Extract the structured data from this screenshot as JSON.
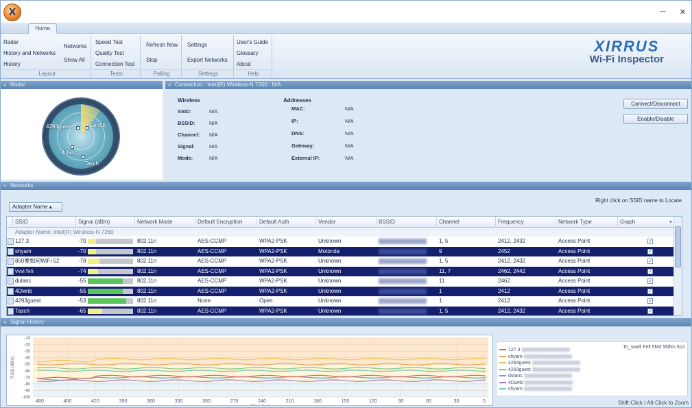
{
  "window": {
    "controls": [
      "⎓",
      "✕"
    ]
  },
  "ribbon": {
    "tab": "Home",
    "groups": {
      "layout": {
        "label": "Layout",
        "items": [
          "Radar",
          "History and Networks",
          "History"
        ],
        "networks": "Networks",
        "show_all": "Show All"
      },
      "tests": {
        "label": "Tests",
        "items": [
          "Speed Test",
          "Quality Test",
          "Connection Test"
        ]
      },
      "polling": {
        "label": "Polling",
        "refresh": "Refresh Now",
        "stop": "Stop"
      },
      "settings": {
        "label": "Settings",
        "settings": "Settings",
        "export": "Export Networks"
      },
      "help": {
        "label": "Help",
        "items": [
          "User's Guide",
          "Glossary",
          "About"
        ]
      }
    },
    "brand": {
      "name": "XIRRUS",
      "product": "Wi-Fi Inspector"
    }
  },
  "radar": {
    "header": "Radar",
    "labels": [
      "4293guest",
      "Ssmdb",
      "dulanc",
      "Tasch"
    ]
  },
  "connection": {
    "header": "Connection : Intel(R) Wireless-N 7260 : N/A",
    "wireless": {
      "title": "Wireless",
      "fields": [
        {
          "label": "SSID:",
          "value": "N/A"
        },
        {
          "label": "BSSID:",
          "value": "N/A"
        },
        {
          "label": "Channel:",
          "value": "N/A"
        },
        {
          "label": "Signal:",
          "value": "N/A"
        },
        {
          "label": "Mode:",
          "value": "N/A"
        }
      ]
    },
    "addresses": {
      "title": "Addresses",
      "fields": [
        {
          "label": "MAC:",
          "value": "N/A"
        },
        {
          "label": "IP:",
          "value": "N/A"
        },
        {
          "label": "DNS:",
          "value": "N/A"
        },
        {
          "label": "Gateway:",
          "value": "N/A"
        },
        {
          "label": "External IP:",
          "value": "N/A"
        }
      ]
    },
    "buttons": {
      "connect": "Connect/Disconnect",
      "enable": "Enable/Disable"
    }
  },
  "networks": {
    "header": "Networks",
    "adapter_button": "Adapter Name ▴",
    "hint": "Right click on SSID name to Locate",
    "group_row": "Adapter Name: Intel(R) Wireless-N 7260",
    "columns": [
      "SSID",
      "Signal (dBm)",
      "Network Mode",
      "Default Encryption",
      "Default Auth",
      "Vendor",
      "BSSID",
      "Channel",
      "Frequency",
      "Network Type",
      "Graph"
    ],
    "rows": [
      {
        "ssid": "127.3",
        "signal": "-70",
        "level": 0.18,
        "bar": "#f2ef8a",
        "mode": "802.11n",
        "enc": "AES-CCMP",
        "auth": "WPA2-PSK",
        "vendor": "Unknown",
        "channel": "1, 5",
        "freq": "2412, 2432",
        "type": "Access Point",
        "selected": false
      },
      {
        "ssid": "shyam",
        "signal": "-70",
        "level": 0.18,
        "bar": "#f2ef8a",
        "mode": "802.11n",
        "enc": "AES-CCMP",
        "auth": "WPA2-PSK",
        "vendor": "Motorola",
        "channel": "9",
        "freq": "2452",
        "type": "Access Point",
        "selected": true
      },
      {
        "ssid": "800室如何WiFi 52",
        "signal": "-78",
        "level": 0.25,
        "bar": "#f2ef8a",
        "mode": "802.11n",
        "enc": "AES-CCMP",
        "auth": "WPA2-PSK",
        "vendor": "Unknown",
        "channel": "1, 5",
        "freq": "2412, 2432",
        "type": "Access Point",
        "selected": false
      },
      {
        "ssid": "vvvi fvn",
        "signal": "-74",
        "level": 0.22,
        "bar": "#f2ef8a",
        "mode": "802.11n",
        "enc": "AES-CCMP",
        "auth": "WPA2-PSK",
        "vendor": "Unknown",
        "channel": "11, 7",
        "freq": "2462, 2442",
        "type": "Access Point",
        "selected": true
      },
      {
        "ssid": "dulanc",
        "signal": "-55",
        "level": 0.78,
        "bar": "#5cc45c",
        "mode": "802.11n",
        "enc": "AES-CCMP",
        "auth": "WPA2-PSK",
        "vendor": "Unknown",
        "channel": "11",
        "freq": "2462",
        "type": "Access Point",
        "selected": false
      },
      {
        "ssid": "4Dwnb",
        "signal": "-55",
        "level": 0.78,
        "bar": "#5cc45c",
        "mode": "802.11n",
        "enc": "AES-CCMP",
        "auth": "WPA2-PSK",
        "vendor": "Unknown",
        "channel": "1",
        "freq": "2412",
        "type": "Access Point",
        "selected": true
      },
      {
        "ssid": "4293guest",
        "signal": "-53",
        "level": 0.85,
        "bar": "#5cc45c",
        "mode": "802.11n",
        "enc": "None",
        "auth": "Open",
        "vendor": "Unknown",
        "channel": "1",
        "freq": "2412",
        "type": "Access Point",
        "selected": false
      },
      {
        "ssid": "Tasch",
        "signal": "-65",
        "level": 0.32,
        "bar": "#f2ef8a",
        "mode": "802.11n",
        "enc": "AES-CCMP",
        "auth": "WPA2-PSK",
        "vendor": "Unknown",
        "channel": "1, 5",
        "freq": "2412, 2432",
        "type": "Access Point",
        "selected": true
      }
    ]
  },
  "signal_history": {
    "header": "Signal History",
    "ylabel": "RSSI (dBm)",
    "xlabel": "Time (sec)",
    "yticks": [
      "-10",
      "-20",
      "-30",
      "-40",
      "-50",
      "-60",
      "-70",
      "-80",
      "-90",
      "-100"
    ],
    "xticks": [
      "480",
      "450",
      "420",
      "390",
      "360",
      "330",
      "300",
      "270",
      "240",
      "210",
      "180",
      "150",
      "120",
      "90",
      "60",
      "30",
      "0"
    ],
    "series": [
      {
        "color": "#f2a35c",
        "level": -50
      },
      {
        "color": "#e7c84c",
        "level": -42
      },
      {
        "color": "#7fc27f",
        "level": -56
      },
      {
        "color": "#6aa8d8",
        "level": -70
      },
      {
        "color": "#9a7cc4",
        "level": -75
      },
      {
        "color": "#d96a6a",
        "level": -68
      },
      {
        "color": "#6fc9c9",
        "level": -60
      }
    ],
    "legend_note": "To_swell Fell 5Md 5fdNn 5cd",
    "legend_items": [
      {
        "prefix": "127.3",
        "color": "#d96a6a"
      },
      {
        "prefix": "shyam",
        "color": "#f2a35c"
      },
      {
        "prefix": "4293guest",
        "color": "#e7c84c"
      },
      {
        "prefix": "4293guest",
        "color": "#7fc27f"
      },
      {
        "prefix": "dulanc",
        "color": "#6aa8d8"
      },
      {
        "prefix": "4Dwnb",
        "color": "#9a7cc4"
      },
      {
        "prefix": "shyam",
        "color": "#6fc9c9"
      }
    ],
    "footer_hint": "Shift-Click / Alt-Click to Zoom"
  }
}
